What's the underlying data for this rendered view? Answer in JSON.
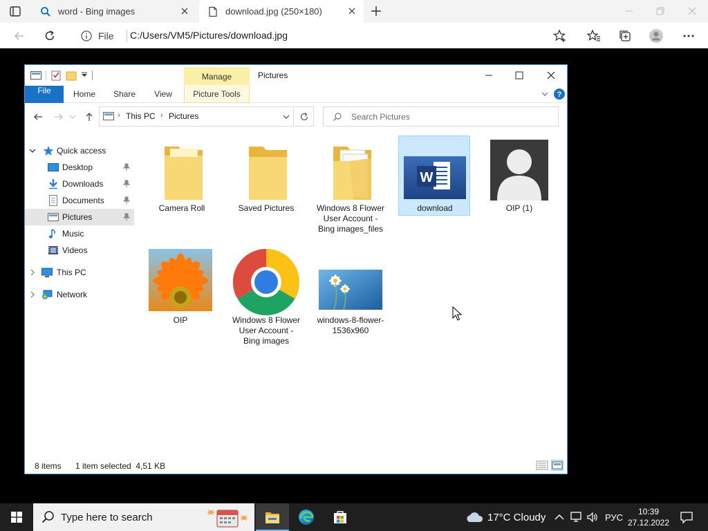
{
  "browser": {
    "tabs": [
      {
        "title": "word - Bing images",
        "icon": "search-icon"
      },
      {
        "title": "download.jpg (250×180)",
        "icon": "page-icon"
      }
    ],
    "site_label": "File",
    "url": "C:/Users/VM5/Pictures/download.jpg"
  },
  "explorer": {
    "manage_label": "Manage",
    "title": "Pictures",
    "ribbon_tabs": [
      "File",
      "Home",
      "Share",
      "View",
      "Picture Tools"
    ],
    "breadcrumb": [
      "This PC",
      "Pictures"
    ],
    "search_placeholder": "Search Pictures",
    "nav": {
      "quick_access": "Quick access",
      "items": [
        {
          "label": "Desktop",
          "icon": "desktop-icon",
          "pinned": true
        },
        {
          "label": "Downloads",
          "icon": "downloads-icon",
          "pinned": true
        },
        {
          "label": "Documents",
          "icon": "documents-icon",
          "pinned": true
        },
        {
          "label": "Pictures",
          "icon": "pictures-icon",
          "pinned": true,
          "selected": true
        },
        {
          "label": "Music",
          "icon": "music-icon"
        },
        {
          "label": "Videos",
          "icon": "videos-icon"
        }
      ],
      "this_pc": "This PC",
      "network": "Network"
    },
    "files": [
      {
        "name": "Camera Roll",
        "type": "folder"
      },
      {
        "name": "Saved Pictures",
        "type": "folder"
      },
      {
        "name": "Windows 8 Flower User Account - Bing images_files",
        "type": "folder-with-files"
      },
      {
        "name": "download",
        "type": "word-image",
        "selected": true
      },
      {
        "name": "OIP (1)",
        "type": "user-image"
      },
      {
        "name": "OIP",
        "type": "flower-image"
      },
      {
        "name": "Windows 8 Flower User Account - Bing images",
        "type": "chrome-html"
      },
      {
        "name": "windows-8-flower-1536x960",
        "type": "daisy-image"
      }
    ],
    "status": {
      "count": "8 items",
      "selection": "1 item selected  4,51 KB"
    }
  },
  "taskbar": {
    "search_placeholder": "Type here to search",
    "weather": "17°C  Cloudy",
    "language": "РУС",
    "time": "10:39",
    "date": "27.12.2022"
  }
}
